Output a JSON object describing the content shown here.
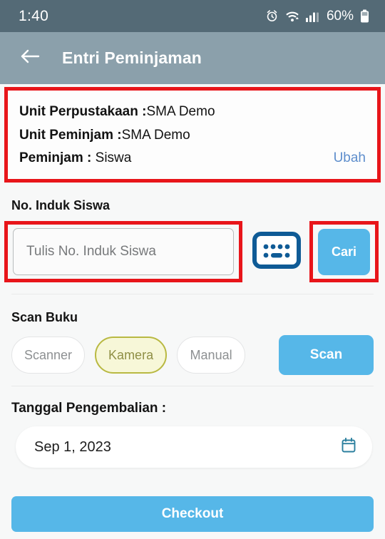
{
  "status_bar": {
    "time": "1:40",
    "battery_percent": "60%",
    "icons": [
      "alarm-clock-icon",
      "wifi-icon",
      "signal-bars-icon",
      "battery-icon"
    ]
  },
  "app_bar": {
    "back_icon": "back-arrow-icon",
    "title": "Entri Peminjaman"
  },
  "info_card": {
    "rows": [
      {
        "label": "Unit Perpustakaan :",
        "value": " SMA Demo"
      },
      {
        "label": "Unit Peminjam :",
        "value": " SMA Demo"
      },
      {
        "label": "Peminjam :",
        "value": " Siswa"
      }
    ],
    "action_label": "Ubah"
  },
  "induk_section": {
    "label": "No. Induk Siswa",
    "input_placeholder": "Tulis No. Induk Siswa",
    "input_value": "",
    "keyboard_icon": "keyboard-icon",
    "search_button_label": "Cari"
  },
  "scan_section": {
    "label": "Scan Buku",
    "options": [
      {
        "label": "Scanner",
        "selected": false
      },
      {
        "label": "Kamera",
        "selected": true
      },
      {
        "label": "Manual",
        "selected": false
      }
    ],
    "scan_button_label": "Scan"
  },
  "date_section": {
    "label": "Tanggal Pengembalian :",
    "value": "Sep 1, 2023",
    "calendar_icon": "calendar-icon"
  },
  "footer": {
    "checkout_label": "Checkout"
  },
  "colors": {
    "status_bar": "#546a76",
    "app_bar": "#8ba0ab",
    "accent_blue": "#56b7e8",
    "link_blue": "#5e8ecc",
    "annotation_red": "#e8151a",
    "keyboard_navy": "#0f5b96",
    "selected_pill_bg": "#f7f7d8",
    "selected_pill_border": "#b9b942",
    "page_bg": "#f7f8f8"
  }
}
